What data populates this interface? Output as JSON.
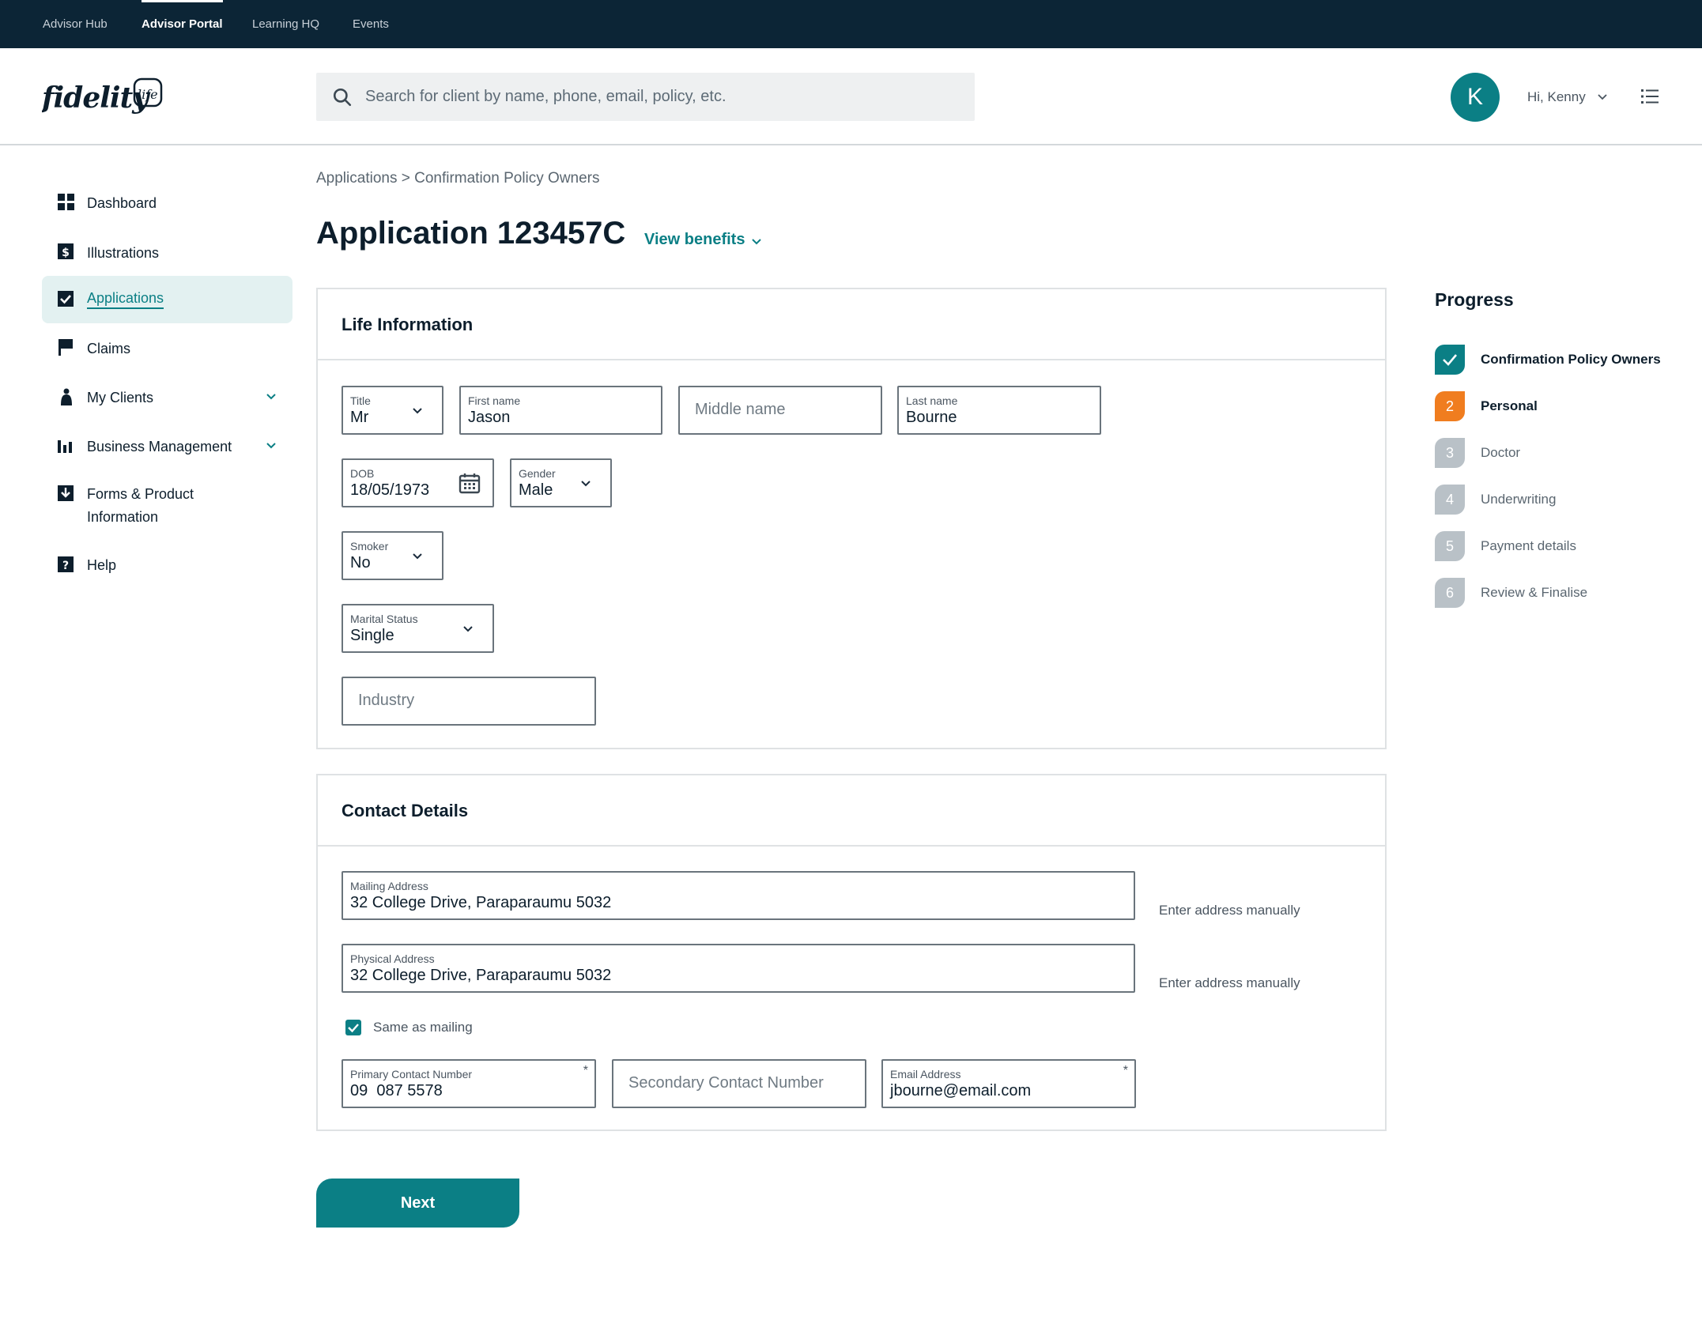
{
  "topnav": {
    "tabs": [
      {
        "label": "Advisor Hub",
        "active": false
      },
      {
        "label": "Advisor Portal",
        "active": true
      },
      {
        "label": "Learning HQ",
        "active": false
      },
      {
        "label": "Events",
        "active": false
      }
    ]
  },
  "header": {
    "logo_text": "fidelity life",
    "search_placeholder": "Search for client by name, phone, email, policy, etc.",
    "avatar_initial": "K",
    "greeting": "Hi, Kenny"
  },
  "sidebar": {
    "items": [
      {
        "label": "Dashboard",
        "icon": "dashboard-icon"
      },
      {
        "label": "Illustrations",
        "icon": "dollar-icon"
      },
      {
        "label": "Applications",
        "icon": "checkbox-icon",
        "active": true
      },
      {
        "label": "Claims",
        "icon": "flag-icon"
      },
      {
        "label": "My Clients",
        "icon": "person-icon",
        "expandable": true
      },
      {
        "label": "Business Management",
        "icon": "bar-chart-icon",
        "expandable": true
      },
      {
        "label": "Forms & Product",
        "label2": "Information",
        "icon": "download-icon"
      },
      {
        "label": "Help",
        "icon": "help-icon"
      }
    ]
  },
  "main": {
    "breadcrumb": "Applications > Confirmation Policy Owners",
    "title": "Application 123457C",
    "view_benefits": "View benefits",
    "life_info": {
      "title": "Life Information",
      "title_field": {
        "label": "Title",
        "value": "Mr"
      },
      "first_name": {
        "label": "First name",
        "value": "Jason"
      },
      "middle_name": {
        "placeholder": "Middle name"
      },
      "last_name": {
        "label": "Last name",
        "value": "Bourne"
      },
      "dob": {
        "label": "DOB",
        "value": "18/05/1973"
      },
      "gender": {
        "label": "Gender",
        "value": "Male"
      },
      "smoker": {
        "label": "Smoker",
        "value": "No"
      },
      "marital": {
        "label": "Marital Status",
        "value": "Single"
      },
      "industry": {
        "placeholder": "Industry"
      }
    },
    "contact": {
      "title": "Contact Details",
      "mailing": {
        "label": "Mailing Address",
        "value": "32 College Drive, Paraparaumu 5032"
      },
      "physical": {
        "label": "Physical Address",
        "value": "32 College Drive, Paraparaumu 5032"
      },
      "enter_manually": "Enter address manually",
      "same_as_mailing": "Same as mailing",
      "primary": {
        "label": "Primary Contact Number",
        "value": "09  087 5578",
        "required_mark": "*"
      },
      "secondary": {
        "placeholder": "Secondary Contact Number"
      },
      "email": {
        "label": "Email Address",
        "value": "jbourne@email.com",
        "required_mark": "*"
      }
    },
    "next_label": "Next"
  },
  "progress": {
    "title": "Progress",
    "steps": [
      {
        "number": "",
        "label": "Confirmation Policy Owners",
        "state": "done"
      },
      {
        "number": "2",
        "label": "Personal",
        "state": "current"
      },
      {
        "number": "3",
        "label": "Doctor",
        "state": "todo"
      },
      {
        "number": "4",
        "label": "Underwriting",
        "state": "todo"
      },
      {
        "number": "5",
        "label": "Payment details",
        "state": "todo"
      },
      {
        "number": "6",
        "label": "Review & Finalise",
        "state": "todo"
      }
    ]
  },
  "colors": {
    "nav_bg": "#0c2536",
    "accent": "#0b7f85",
    "current_step": "#f07d1f",
    "inactive_step": "#b9c1c7"
  }
}
